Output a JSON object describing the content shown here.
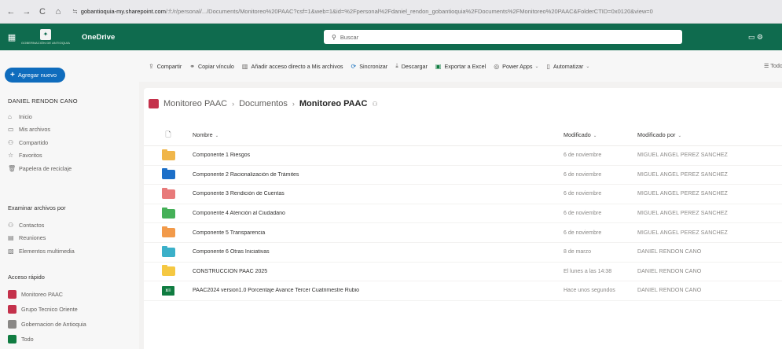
{
  "browser": {
    "nav": {
      "back": "←",
      "forward": "→",
      "reload": "C",
      "home": "⌂"
    },
    "site_icon": "≒",
    "url_host": "gobantioquia-my.sharepoint.com",
    "url_rest": "/:f:/r/personal/.../Documents/Monitoreo%20PAAC?csf=1&web=1&id=%2Fpersonal%2Fdaniel_rendon_gobantioquia%2FDocuments%2FMonitoreo%20PAAC&FolderCTID=0x0120&view=0"
  },
  "suitebar": {
    "waffle_icon": "▦",
    "app_name": "OneDrive",
    "search_placeholder": "Buscar",
    "search_icon": "⚲",
    "right_icon": "▭ ⚙"
  },
  "sidebar": {
    "new_label": "Agregar nuevo",
    "user_name": "DANIEL RENDON CANO",
    "items": [
      {
        "icon": "⌂",
        "label": "Inicio"
      },
      {
        "icon": "▭",
        "label": "Mis archivos"
      },
      {
        "icon": "⚇",
        "label": "Compartido"
      },
      {
        "icon": "☆",
        "label": "Favoritos"
      },
      {
        "icon": "🗑",
        "label": "Papelera de reciclaje"
      }
    ],
    "explore_header": "Examinar archivos por",
    "explore": [
      {
        "icon": "⚇",
        "label": "Contactos"
      },
      {
        "icon": "▤",
        "label": "Reuniones"
      },
      {
        "icon": "▧",
        "label": "Elementos multimedia"
      }
    ],
    "quick_header": "Acceso rápido",
    "quick": [
      {
        "label": "Monitoreo PAAC",
        "color": "#c4314b"
      },
      {
        "label": "Grupo Tecnico Oriente",
        "color": "#c4314b"
      },
      {
        "label": "Gobernacion de Antioquia",
        "color": "#8a8886"
      },
      {
        "label": "Todo",
        "color": "#107c41"
      }
    ]
  },
  "commands": [
    {
      "icon": "⇪",
      "label": "Compartir"
    },
    {
      "icon": "⚭",
      "label": "Copiar vínculo"
    },
    {
      "icon": "▥",
      "label": "Añadir acceso directo a Mis archivos"
    },
    {
      "icon": "⟳",
      "label": "Sincronizar",
      "style": "blue"
    },
    {
      "icon": "⤓",
      "label": "Descargar"
    },
    {
      "icon": "▣",
      "label": "Exportar a Excel",
      "style": "green"
    },
    {
      "icon": "◎",
      "label": "Power Apps",
      "dropdown": true
    },
    {
      "icon": "▯",
      "label": "Automatizar",
      "dropdown": true
    }
  ],
  "command_right": "☰ Todo",
  "breadcrumb": {
    "items": [
      "Monitoreo PAAC",
      "Documentos"
    ],
    "separator": "›",
    "current": "Monitoreo PAAC",
    "share_icon": "⚇"
  },
  "table": {
    "columns": {
      "type_icon": "🗋",
      "name": "Nombre",
      "modified": "Modificado",
      "modified_by": "Modificado por"
    },
    "rows": [
      {
        "kind": "folder",
        "color": "#f0b64a",
        "name": "Componente 1 Riesgos",
        "modified": "6 de noviembre",
        "by": "MIGUEL ANGEL PEREZ SANCHEZ"
      },
      {
        "kind": "folder",
        "color": "#1c6fc8",
        "name": "Componente 2 Racionalización de Trámites",
        "modified": "6 de noviembre",
        "by": "MIGUEL ANGEL PEREZ SANCHEZ"
      },
      {
        "kind": "folder",
        "color": "#e87a7a",
        "name": "Componente 3 Rendición de Cuentas",
        "modified": "6 de noviembre",
        "by": "MIGUEL ANGEL PEREZ SANCHEZ"
      },
      {
        "kind": "folder",
        "color": "#45b058",
        "name": "Componente 4 Atención al Ciudadano",
        "modified": "6 de noviembre",
        "by": "MIGUEL ANGEL PEREZ SANCHEZ"
      },
      {
        "kind": "folder",
        "color": "#f29a4a",
        "name": "Componente 5 Transparencia",
        "modified": "6 de noviembre",
        "by": "MIGUEL ANGEL PEREZ SANCHEZ"
      },
      {
        "kind": "folder",
        "color": "#3bb0c9",
        "name": "Componente 6 Otras Iniciativas",
        "modified": "8 de marzo",
        "by": "DANIEL RENDON CANO"
      },
      {
        "kind": "folder",
        "color": "#f5c842",
        "name": "CONSTRUCCIÓN PAAC 2025",
        "modified": "El lunes a las 14:38",
        "by": "DANIEL RENDON CANO"
      },
      {
        "kind": "xlsx",
        "color": "#107c41",
        "icon_text": "x≡",
        "name": "PAAC2024 version1.0 Porcentaje Avance Tercer Cuatrimestre Rubio",
        "modified": "Hace unos segundos",
        "by": "DANIEL RENDON CANO"
      }
    ]
  }
}
